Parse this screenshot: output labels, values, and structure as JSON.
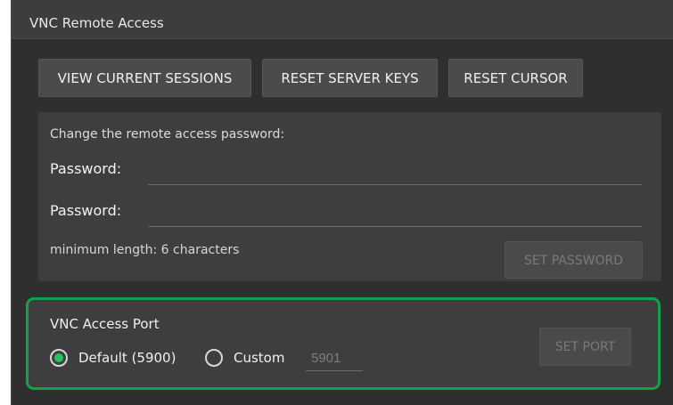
{
  "window": {
    "title": "VNC Remote Access"
  },
  "toolbar": {
    "view_sessions_label": "VIEW CURRENT SESSIONS",
    "reset_keys_label": "RESET SERVER KEYS",
    "reset_cursor_label": "RESET CURSOR"
  },
  "password_section": {
    "heading": "Change the remote access password:",
    "password_label_1": "Password:",
    "password_value_1": "",
    "password_label_2": "Password:",
    "password_value_2": "",
    "hint": "minimum length: 6 characters",
    "set_button_label": "SET PASSWORD"
  },
  "port_section": {
    "title": "VNC Access Port",
    "default_option_label": "Default (5900)",
    "default_selected": true,
    "custom_option_label": "Custom",
    "custom_port_placeholder": "5901",
    "set_button_label": "SET PORT",
    "highlight_color": "#12a24b",
    "selected_radio_color": "#22c45d"
  }
}
